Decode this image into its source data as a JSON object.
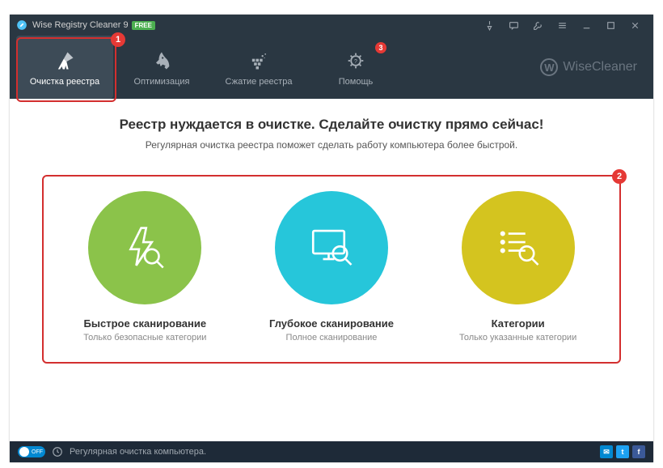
{
  "titlebar": {
    "app_name": "Wise Registry Cleaner 9",
    "free_badge": "FREE"
  },
  "nav": {
    "items": [
      {
        "label": "Очистка реестра"
      },
      {
        "label": "Оптимизация"
      },
      {
        "label": "Сжатие реестра"
      },
      {
        "label": "Помощь",
        "badge": "3"
      }
    ],
    "brand": "WiseCleaner"
  },
  "main": {
    "heading": "Реестр нуждается в очистке. Сделайте очистку прямо сейчас!",
    "subheading": "Регулярная очистка реестра поможет сделать работу компьютера более быстрой.",
    "options": [
      {
        "title": "Быстрое сканирование",
        "sub": "Только безопасные категории"
      },
      {
        "title": "Глубокое сканирование",
        "sub": "Полное сканирование"
      },
      {
        "title": "Категории",
        "sub": "Только указанные категории"
      }
    ]
  },
  "footer": {
    "toggle": "OFF",
    "text": "Регулярная очистка компьютера."
  },
  "annotations": {
    "b1": "1",
    "b2": "2"
  }
}
